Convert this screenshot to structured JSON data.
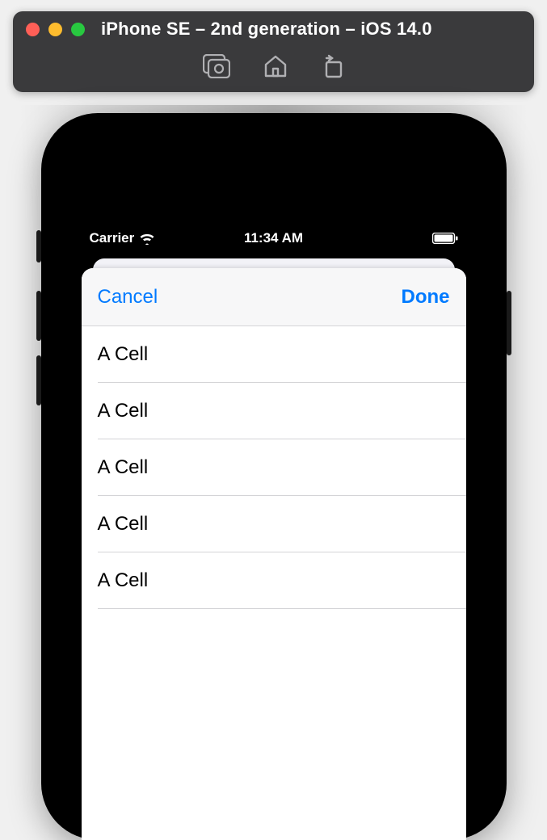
{
  "simulator": {
    "window_title": "iPhone SE – 2nd generation – iOS 14.0",
    "toolbar": {
      "screenshot": "screenshot-icon",
      "home": "home-icon",
      "rotate": "rotate-icon"
    }
  },
  "device": {
    "status_bar": {
      "carrier": "Carrier",
      "time": "11:34 AM"
    },
    "sheet": {
      "nav": {
        "cancel_label": "Cancel",
        "done_label": "Done"
      },
      "cells": [
        {
          "label": "A Cell"
        },
        {
          "label": "A Cell"
        },
        {
          "label": "A Cell"
        },
        {
          "label": "A Cell"
        },
        {
          "label": "A Cell"
        }
      ]
    }
  }
}
